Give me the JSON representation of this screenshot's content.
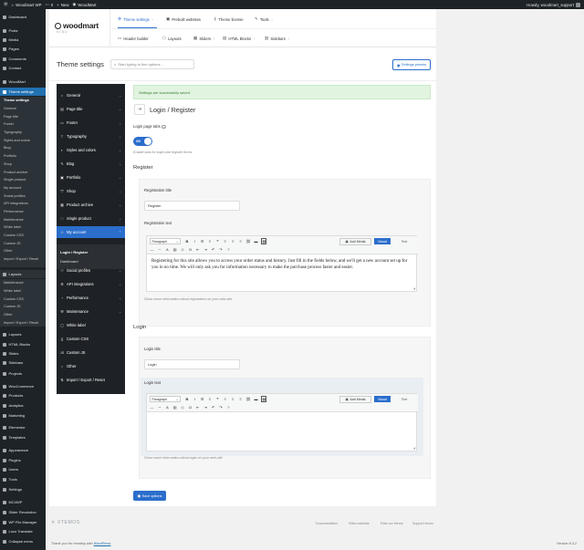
{
  "admin_bar": {
    "site_name": "Woodmart WP",
    "comments_count": "0",
    "new_label": "New",
    "plugin_label": "WoodMart",
    "howdy": "Howdy, woodmart_support"
  },
  "sidebar": {
    "items": [
      {
        "label": "Dashboard",
        "icon": "dashboard-icon"
      },
      {
        "label": "Posts",
        "icon": "pin-icon"
      },
      {
        "label": "Media",
        "icon": "media-icon"
      },
      {
        "label": "Pages",
        "icon": "page-icon"
      },
      {
        "label": "Comments",
        "icon": "comment-icon"
      },
      {
        "label": "Contact",
        "icon": "mail-icon"
      },
      {
        "label": "WoodMart",
        "icon": "woodmart-icon"
      },
      {
        "label": "Theme settings",
        "icon": "settings-icon"
      }
    ],
    "theme_settings_sub": [
      "Theme settings",
      "General",
      "Page title",
      "Footer",
      "Typography",
      "Styles and colors",
      "Blog",
      "Portfolio",
      "Shop",
      "Product archive",
      "Single product",
      "My account",
      "Social profiles",
      "API integrations",
      "Performance",
      "Maintenance",
      "White label",
      "Custom CSS",
      "Custom JS",
      "Other",
      "Import / Export / Reset"
    ],
    "layouts_label": "Layouts",
    "layouts_sub": [
      "Maintenance",
      "White label",
      "Custom CSS",
      "Custom JS",
      "Other",
      "Import / Export / Reset"
    ],
    "items_after": [
      {
        "label": "Layouts",
        "icon": "layouts-icon"
      },
      {
        "label": "HTML Blocks",
        "icon": "blocks-icon"
      },
      {
        "label": "Slides",
        "icon": "slides-icon"
      },
      {
        "label": "Sidebars",
        "icon": "sidebars-icon"
      },
      {
        "label": "Projects",
        "icon": "projects-icon"
      },
      {
        "label": "WooCommerce",
        "icon": "woo-icon"
      },
      {
        "label": "Products",
        "icon": "products-icon"
      },
      {
        "label": "Analytics",
        "icon": "analytics-icon"
      },
      {
        "label": "Marketing",
        "icon": "marketing-icon"
      },
      {
        "label": "Elementor",
        "icon": "elementor-icon"
      },
      {
        "label": "Templates",
        "icon": "templates-icon"
      },
      {
        "label": "Appearance",
        "icon": "appearance-icon"
      },
      {
        "label": "Plugins",
        "icon": "plugins-icon"
      },
      {
        "label": "Users",
        "icon": "users-icon"
      },
      {
        "label": "Tools",
        "icon": "tools-icon"
      },
      {
        "label": "Settings",
        "icon": "settings-icon"
      },
      {
        "label": "MC4WP",
        "icon": "mc4wp-icon"
      },
      {
        "label": "Slider Revolution",
        "icon": "slider-icon"
      },
      {
        "label": "WP File Manager",
        "icon": "folder-icon"
      },
      {
        "label": "Loco Translate",
        "icon": "translate-icon"
      },
      {
        "label": "Collapse menu",
        "icon": "collapse-icon"
      }
    ]
  },
  "woodmart": {
    "logo": "woodmart",
    "version": "v.7.5.1",
    "top_nav": [
      {
        "label": "Theme settings",
        "icon": "settings-icon"
      },
      {
        "label": "Prebuilt websites",
        "icon": "websites-icon"
      },
      {
        "label": "Theme license",
        "icon": "key-icon"
      },
      {
        "label": "Tools",
        "icon": "wrench-icon"
      }
    ],
    "sub_nav": [
      {
        "label": "Header builder",
        "icon": "header-icon"
      },
      {
        "label": "Layouts",
        "icon": "layouts-icon"
      },
      {
        "label": "Sliders",
        "icon": "sliders-icon"
      },
      {
        "label": "HTML Blocks",
        "icon": "html-icon"
      },
      {
        "label": "Sidebars",
        "icon": "sidebars-icon"
      }
    ]
  },
  "page": {
    "title": "Theme settings",
    "search_placeholder": "Start typing to find options...",
    "presets_label": "Settings presets"
  },
  "settings_nav": {
    "items": [
      {
        "label": "General",
        "icon": "⌂"
      },
      {
        "label": "Page title",
        "icon": "▤"
      },
      {
        "label": "Footer",
        "icon": "▭"
      },
      {
        "label": "Typography",
        "icon": "T"
      },
      {
        "label": "Styles and colors",
        "icon": "◐"
      },
      {
        "label": "Blog",
        "icon": "✎"
      },
      {
        "label": "Portfolio",
        "icon": "▣"
      },
      {
        "label": "Shop",
        "icon": "⛉"
      },
      {
        "label": "Product archive",
        "icon": "▦"
      },
      {
        "label": "Single product",
        "icon": "□"
      },
      {
        "label": "My account",
        "icon": "☺"
      },
      {
        "label": "Social profiles",
        "icon": "⚇"
      },
      {
        "label": "API integrations",
        "icon": "⚙"
      },
      {
        "label": "Performance",
        "icon": "◔"
      },
      {
        "label": "Maintenance",
        "icon": "⚒"
      },
      {
        "label": "White label",
        "icon": "▢"
      },
      {
        "label": "Custom CSS",
        "icon": "{}"
      },
      {
        "label": "Custom JS",
        "icon": "JS"
      },
      {
        "label": "Other",
        "icon": "○"
      },
      {
        "label": "Import / Export / Reset",
        "icon": "⇅"
      }
    ],
    "my_account_sub": [
      "Login / Register",
      "Dashboard"
    ]
  },
  "content": {
    "notice": "Settings are successfully saved.",
    "section_title": "Login / Register",
    "login_tabs_label": "Login page tabs",
    "toggle_state": "ON",
    "login_tabs_desc": "Enable tabs for login and register forms",
    "register": {
      "heading": "Register",
      "title_label": "Registration title",
      "title_value": "Register",
      "text_label": "Registration text",
      "text_value": "Registering for this site allows you to access your order status and history. Just fill in the fields below, and we'll get a new account set up for you in no time. We will only ask you for information necessary to make the purchase process faster and easier.",
      "desc": "Show some information about registration on your web-site"
    },
    "login": {
      "heading": "Login",
      "title_label": "Login title",
      "title_value": "Login",
      "text_label": "Login text",
      "text_value": "",
      "desc": "Show some information about login on your web-site"
    },
    "editor": {
      "format": "Paragraph",
      "add_media": "Add Media",
      "visual": "Visual",
      "text": "Text"
    },
    "save_label": "Save options"
  },
  "footer": {
    "brand": "XTEMOS",
    "links": [
      "Documentation",
      "Video tutorials",
      "Rate our theme",
      "Support forum"
    ],
    "thanks_prefix": "Thank you for creating with",
    "thanks_link": "WordPress",
    "version": "Version 6.3.2"
  },
  "colors": {
    "accent": "#2b6ecc",
    "wp_admin": "#1d2327",
    "wp_blue": "#2271b1",
    "notice_bg": "#e1f4e0"
  }
}
